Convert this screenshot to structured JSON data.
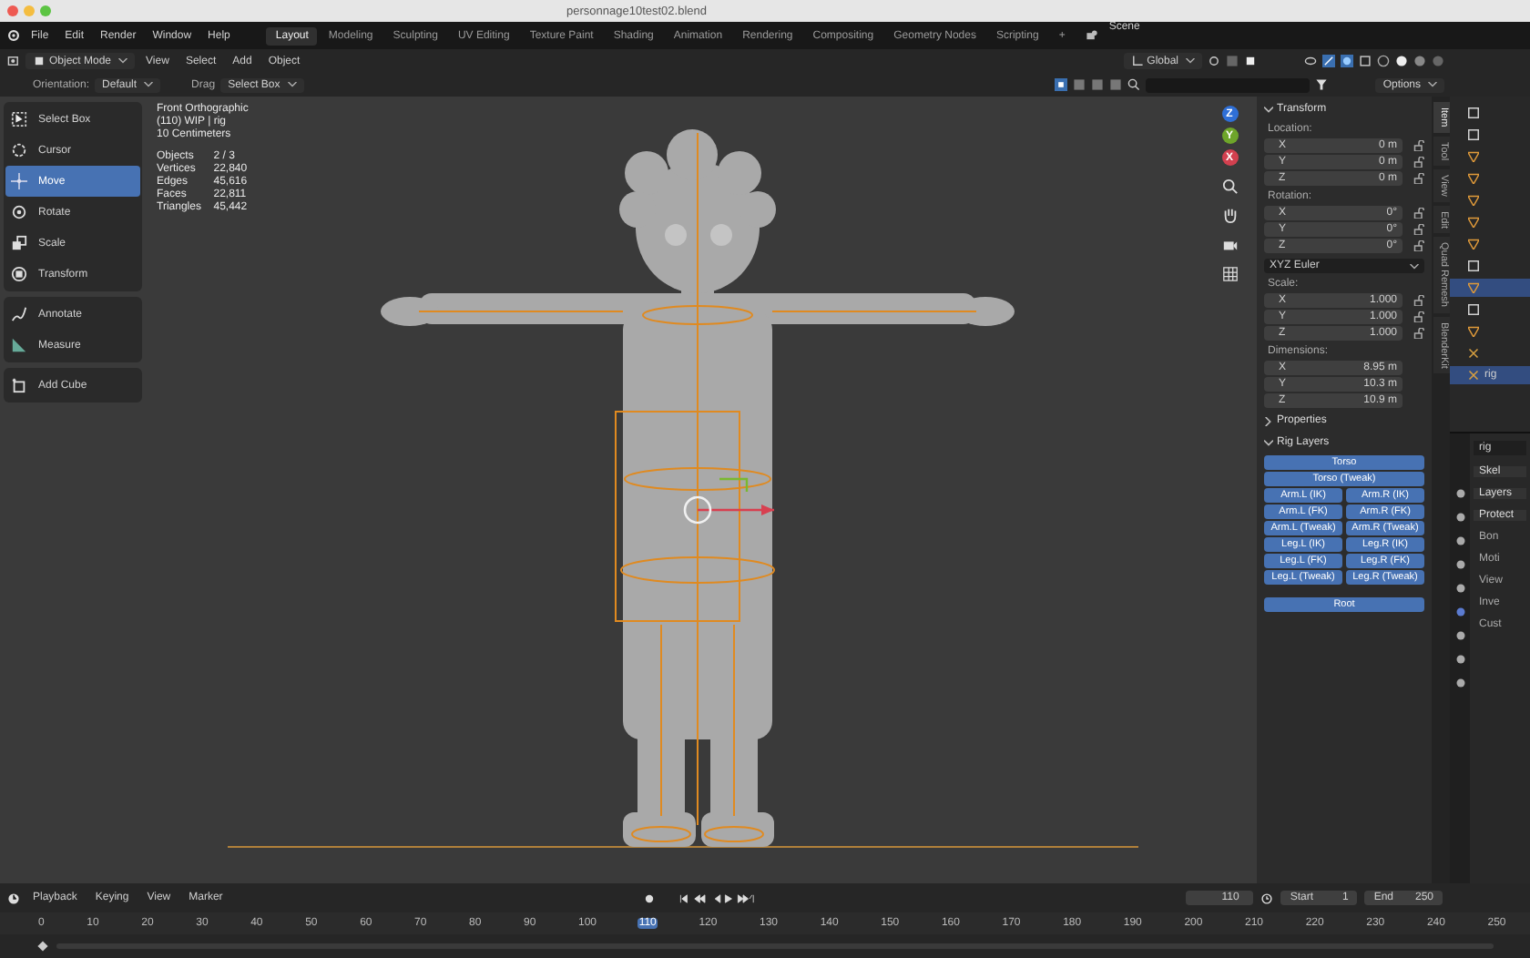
{
  "window": {
    "title": "personnage10test02.blend"
  },
  "menu": [
    "File",
    "Edit",
    "Render",
    "Window",
    "Help"
  ],
  "workspaces": [
    {
      "label": "Layout",
      "selected": true
    },
    {
      "label": "Modeling",
      "selected": false
    },
    {
      "label": "Sculpting",
      "selected": false
    },
    {
      "label": "UV Editing",
      "selected": false
    },
    {
      "label": "Texture Paint",
      "selected": false
    },
    {
      "label": "Shading",
      "selected": false
    },
    {
      "label": "Animation",
      "selected": false
    },
    {
      "label": "Rendering",
      "selected": false
    },
    {
      "label": "Compositing",
      "selected": false
    },
    {
      "label": "Geometry Nodes",
      "selected": false
    },
    {
      "label": "Scripting",
      "selected": false
    }
  ],
  "add_workspace": "+",
  "scene": "Scene",
  "header": {
    "mode": "Object Mode",
    "menus": [
      "View",
      "Select",
      "Add",
      "Object"
    ],
    "transform": "Global"
  },
  "tool_settings": {
    "orientation_label": "Orientation:",
    "orientation": "Default",
    "drag_label": "Drag",
    "drag": "Select Box",
    "options": "Options"
  },
  "tool_groups": [
    [
      {
        "label": "Select Box",
        "kind": "select",
        "selected": false
      },
      {
        "label": "Cursor",
        "kind": "cursor",
        "selected": false
      },
      {
        "label": "Move",
        "kind": "move",
        "selected": true
      },
      {
        "label": "Rotate",
        "kind": "rotate",
        "selected": false
      },
      {
        "label": "Scale",
        "kind": "scale",
        "selected": false
      },
      {
        "label": "Transform",
        "kind": "transform",
        "selected": false
      }
    ],
    [
      {
        "label": "Annotate",
        "kind": "annotate",
        "selected": false
      },
      {
        "label": "Measure",
        "kind": "measure",
        "selected": false
      }
    ],
    [
      {
        "label": "Add Cube",
        "kind": "cube",
        "selected": false
      }
    ]
  ],
  "overlay": {
    "view": "Front Orthographic",
    "collection": "(110) WIP | rig",
    "scale": "10 Centimeters",
    "stats": [
      {
        "label": "Objects",
        "value": "2 / 3"
      },
      {
        "label": "Vertices",
        "value": "22,840"
      },
      {
        "label": "Edges",
        "value": "45,616"
      },
      {
        "label": "Faces",
        "value": "22,811"
      },
      {
        "label": "Triangles",
        "value": "45,442"
      }
    ]
  },
  "gizmo_axes": [
    {
      "label": "Z",
      "color": "#2f6fd6"
    },
    {
      "label": "Y",
      "color": "#6ea52a"
    },
    {
      "label": "X",
      "color": "#d2404f"
    }
  ],
  "sidebar": {
    "tabs": [
      {
        "label": "Item",
        "selected": true
      },
      {
        "label": "Tool",
        "selected": false
      },
      {
        "label": "View",
        "selected": false
      },
      {
        "label": "Edit",
        "selected": false
      },
      {
        "label": "Quad Remesh",
        "selected": false
      },
      {
        "label": "BlenderKit",
        "selected": false
      }
    ],
    "transform": {
      "title": "Transform",
      "expanded": true,
      "groups": [
        {
          "label": "Location:",
          "lockable": true,
          "rows": [
            {
              "axis": "X",
              "value": "0 m"
            },
            {
              "axis": "Y",
              "value": "0 m"
            },
            {
              "axis": "Z",
              "value": "0 m"
            }
          ]
        },
        {
          "label": "Rotation:",
          "lockable": true,
          "rows": [
            {
              "axis": "X",
              "value": "0°"
            },
            {
              "axis": "Y",
              "value": "0°"
            },
            {
              "axis": "Z",
              "value": "0°"
            }
          ],
          "mode": "XYZ Euler"
        },
        {
          "label": "Scale:",
          "lockable": true,
          "rows": [
            {
              "axis": "X",
              "value": "1.000"
            },
            {
              "axis": "Y",
              "value": "1.000"
            },
            {
              "axis": "Z",
              "value": "1.000"
            }
          ]
        },
        {
          "label": "Dimensions:",
          "lockable": false,
          "rows": [
            {
              "axis": "X",
              "value": "8.95 m"
            },
            {
              "axis": "Y",
              "value": "10.3 m"
            },
            {
              "axis": "Z",
              "value": "10.9 m"
            }
          ]
        }
      ]
    },
    "properties": {
      "title": "Properties",
      "expanded": false
    },
    "rig_layers": {
      "title": "Rig Layers",
      "expanded": true,
      "rows": [
        [
          {
            "label": "Torso",
            "on": true
          }
        ],
        [
          {
            "label": "Torso (Tweak)",
            "on": true
          }
        ],
        [
          {
            "label": "Arm.L (IK)",
            "on": true
          },
          {
            "label": "Arm.R (IK)",
            "on": true
          }
        ],
        [
          {
            "label": "Arm.L (FK)",
            "on": true
          },
          {
            "label": "Arm.R (FK)",
            "on": true
          }
        ],
        [
          {
            "label": "Arm.L (Tweak)",
            "on": true
          },
          {
            "label": "Arm.R (Tweak)",
            "on": true
          }
        ],
        [
          {
            "label": "Leg.L (IK)",
            "on": true
          },
          {
            "label": "Leg.R (IK)",
            "on": true
          }
        ],
        [
          {
            "label": "Leg.L (FK)",
            "on": true
          },
          {
            "label": "Leg.R (FK)",
            "on": true
          }
        ],
        [
          {
            "label": "Leg.L (Tweak)",
            "on": true
          },
          {
            "label": "Leg.R (Tweak)",
            "on": true
          }
        ]
      ],
      "root": {
        "label": "Root",
        "on": true
      }
    }
  },
  "outliner": {
    "rows": [
      {
        "kind": "collection",
        "selected": false
      },
      {
        "kind": "collection",
        "selected": false
      },
      {
        "kind": "mesh",
        "selected": false
      },
      {
        "kind": "mesh",
        "selected": false
      },
      {
        "kind": "mesh",
        "selected": false
      },
      {
        "kind": "mesh",
        "selected": false
      },
      {
        "kind": "mesh",
        "selected": false
      },
      {
        "kind": "collection",
        "selected": false
      },
      {
        "kind": "mesh",
        "selected": true
      },
      {
        "kind": "collection",
        "selected": false
      },
      {
        "kind": "mesh",
        "selected": false
      },
      {
        "kind": "armature",
        "selected": false
      },
      {
        "kind": "armature",
        "selected": true,
        "label": "rig"
      }
    ]
  },
  "properties_editor": {
    "object": "rig",
    "sections": [
      {
        "label": "Skel",
        "expanded": true
      },
      {
        "label": "Layers",
        "expanded": true
      },
      {
        "label": "Protect",
        "expanded": true
      },
      {
        "label": "Bon",
        "expanded": false
      },
      {
        "label": "Moti",
        "expanded": false
      },
      {
        "label": "View",
        "expanded": false
      },
      {
        "label": "Inve",
        "expanded": false
      },
      {
        "label": "Cust",
        "expanded": false
      }
    ]
  },
  "timeline": {
    "menus": [
      "Playback",
      "Keying",
      "View",
      "Marker"
    ],
    "current_frame": "110",
    "start_label": "Start",
    "start": "1",
    "end_label": "End",
    "end": "250",
    "ticks": [
      {
        "label": "0",
        "selected": false
      },
      {
        "label": "10",
        "selected": false
      },
      {
        "label": "20",
        "selected": false
      },
      {
        "label": "30",
        "selected": false
      },
      {
        "label": "40",
        "selected": false
      },
      {
        "label": "50",
        "selected": false
      },
      {
        "label": "60",
        "selected": false
      },
      {
        "label": "70",
        "selected": false
      },
      {
        "label": "80",
        "selected": false
      },
      {
        "label": "90",
        "selected": false
      },
      {
        "label": "100",
        "selected": false
      },
      {
        "label": "110",
        "selected": true
      },
      {
        "label": "120",
        "selected": false
      },
      {
        "label": "130",
        "selected": false
      },
      {
        "label": "140",
        "selected": false
      },
      {
        "label": "150",
        "selected": false
      },
      {
        "label": "160",
        "selected": false
      },
      {
        "label": "170",
        "selected": false
      },
      {
        "label": "180",
        "selected": false
      },
      {
        "label": "190",
        "selected": false
      },
      {
        "label": "200",
        "selected": false
      },
      {
        "label": "210",
        "selected": false
      },
      {
        "label": "220",
        "selected": false
      },
      {
        "label": "230",
        "selected": false
      },
      {
        "label": "240",
        "selected": false
      },
      {
        "label": "250",
        "selected": false
      }
    ]
  }
}
